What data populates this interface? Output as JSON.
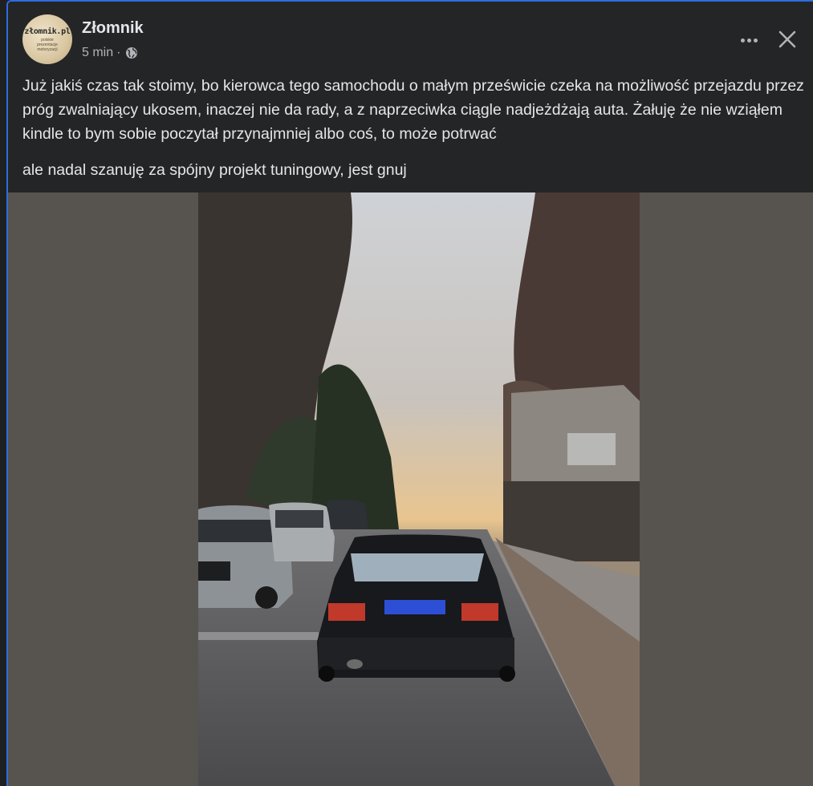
{
  "post": {
    "author": "Złomnik",
    "avatar_text": "złomnik.pl",
    "avatar_subtext": "polskie prezentacje motoryzacji",
    "time": "5 min",
    "separator": "·",
    "privacy_icon": "globe-icon",
    "paragraphs": [
      "Już jakiś czas tak stoimy, bo kierowca tego samochodu o małym prześwicie czeka na możliwość przejazdu przez próg zwalniający ukosem, inaczej nie da rady, a z naprzeciwka ciągle nadjeżdżają auta. Żałuję że nie wziąłem kindle to bym sobie poczytał przynajmniej albo coś, to może potrwać",
      "ale nadal szanuję za spójny projekt tuningowy, jest gnuj"
    ]
  },
  "actions": {
    "more_icon": "more-horizontal-icon",
    "close_icon": "close-icon"
  },
  "colors": {
    "background": "#242526",
    "text": "#e4e6eb",
    "secondary_text": "#b0b3b8",
    "media_background": "#57534f",
    "accent_border": "#2d6cdf"
  }
}
